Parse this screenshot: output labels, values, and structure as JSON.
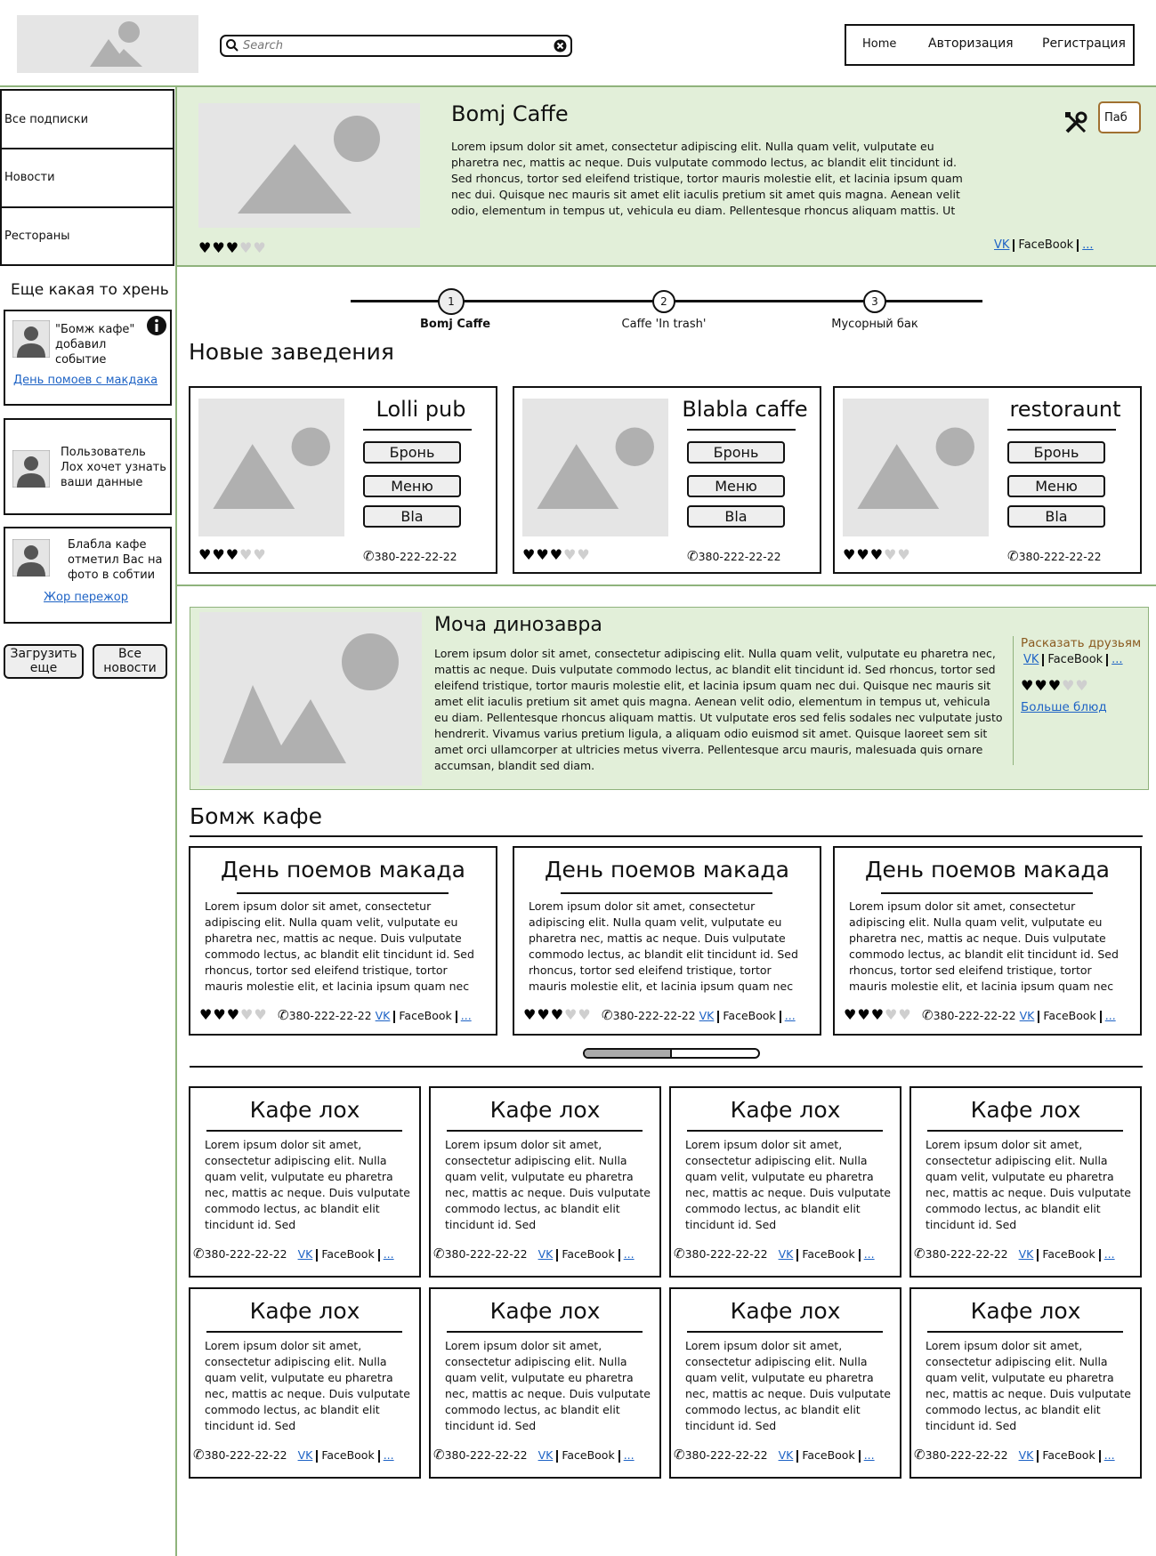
{
  "header": {
    "search_placeholder": "Search",
    "nav": [
      "Home",
      "Авторизация",
      "Регистрация"
    ]
  },
  "sidebar": {
    "menu": [
      "Все подписки",
      "Новости",
      "Рестораны"
    ],
    "section_title": "Еще какая то хрень",
    "notifications": [
      {
        "text": "\"Бомж кафе\" добавил событие",
        "link": "День помоев с макдака"
      },
      {
        "text": "Пользователь Лох хочет узнать ваши данные",
        "link": ""
      },
      {
        "text": "Блабла кафе отметил Вас на фото в собтии",
        "link": "Жор пережор"
      }
    ],
    "load_more": "Загрузить еще",
    "all_news": "Все новости"
  },
  "featured": {
    "title": "Bomj Caffe",
    "text": "Lorem ipsum dolor sit amet, consectetur adipiscing elit. Nulla quam velit, vulputate eu pharetra nec, mattis ac neque. Duis vulputate commodo lectus, ac blandit elit tincidunt id. Sed rhoncus, tortor sed eleifend tristique, tortor mauris molestie elit, et lacinia ipsum quam nec dui. Quisque nec mauris sit amet elit iaculis pretium sit amet quis magna. Aenean velit odio, elementum in tempus ut, vehicula eu diam. Pellentesque rhoncus aliquam mattis. Ut",
    "rating": 3,
    "callout": "Паб",
    "links": {
      "vk": "VK",
      "fb": "FaceBook",
      "more": "..."
    }
  },
  "stepper": {
    "steps": [
      {
        "num": "1",
        "label": "Bomj Caffe"
      },
      {
        "num": "2",
        "label": "Caffe 'In trash'"
      },
      {
        "num": "3",
        "label": "Мусорный бак"
      }
    ]
  },
  "new_places": {
    "heading": "Новые заведения",
    "cards": [
      {
        "name": "Lolli pub",
        "buttons": [
          "Бронь",
          "Меню",
          "Bla"
        ],
        "rating": 3,
        "phone": "380-222-22-22"
      },
      {
        "name": "Blabla caffe",
        "buttons": [
          "Бронь",
          "Меню",
          "Bla"
        ],
        "rating": 3,
        "phone": "380-222-22-22"
      },
      {
        "name": "restoraunt",
        "buttons": [
          "Бронь",
          "Меню",
          "Bla"
        ],
        "rating": 3,
        "phone": "380-222-22-22"
      }
    ]
  },
  "dish": {
    "title": "Моча динозавра",
    "text": "Lorem ipsum dolor sit amet, consectetur adipiscing elit. Nulla quam velit, vulputate eu pharetra nec, mattis ac neque. Duis vulputate commodo lectus, ac blandit elit tincidunt id. Sed rhoncus, tortor sed eleifend tristique, tortor mauris molestie elit, et lacinia ipsum quam nec dui. Quisque nec mauris sit amet elit iaculis pretium sit amet quis magna. Aenean velit odio, elementum in tempus ut, vehicula eu diam. Pellentesque rhoncus aliquam mattis. Ut vulputate eros sed felis sodales nec vulputate justo hendrerit. Vivamus varius pretium ligula, a aliquam odio euismod sit amet. Quisque laoreet sem sit amet orci ullamcorper at ultricies metus viverra. Pellentesque arcu mauris, malesuada quis ornare accumsan, blandit sed diam.",
    "share": "Расказать друзьям",
    "rating": 3,
    "more_dishes": "Больше блюд",
    "links": {
      "vk": "VK",
      "fb": "FaceBook",
      "more": "..."
    }
  },
  "bomj_section": {
    "heading": "Бомж кафе",
    "events": [
      {
        "title": "День поемов макада",
        "text": "Lorem ipsum dolor sit amet, consectetur adipiscing elit. Nulla quam velit, vulputate eu pharetra nec, mattis ac neque. Duis vulputate commodo lectus, ac blandit elit tincidunt id. Sed rhoncus, tortor sed eleifend tristique, tortor mauris molestie elit, et lacinia ipsum quam nec",
        "rating": 3,
        "phone": "380-222-22-22"
      },
      {
        "title": "День поемов макада",
        "text": "Lorem ipsum dolor sit amet, consectetur adipiscing elit. Nulla quam velit, vulputate eu pharetra nec, mattis ac neque. Duis vulputate commodo lectus, ac blandit elit tincidunt id. Sed rhoncus, tortor sed eleifend tristique, tortor mauris molestie elit, et lacinia ipsum quam nec",
        "rating": 3,
        "phone": "380-222-22-22"
      },
      {
        "title": "День поемов макада",
        "text": "Lorem ipsum dolor sit amet, consectetur adipiscing elit. Nulla quam velit, vulputate eu pharetra nec, mattis ac neque. Duis vulputate commodo lectus, ac blandit elit tincidunt id. Sed rhoncus, tortor sed eleifend tristique, tortor mauris molestie elit, et lacinia ipsum quam nec",
        "rating": 3,
        "phone": "380-222-22-22"
      }
    ],
    "scroll_position": 0.5
  },
  "cafes": {
    "items": [
      {
        "title": "Кафе лох",
        "text": "Lorem ipsum dolor sit amet, consectetur adipiscing elit. Nulla quam velit, vulputate eu pharetra nec, mattis ac neque. Duis vulputate commodo lectus, ac blandit elit tincidunt id. Sed",
        "phone": "380-222-22-22"
      },
      {
        "title": "Кафе лох",
        "text": "Lorem ipsum dolor sit amet, consectetur adipiscing elit. Nulla quam velit, vulputate eu pharetra nec, mattis ac neque. Duis vulputate commodo lectus, ac blandit elit tincidunt id. Sed",
        "phone": "380-222-22-22"
      },
      {
        "title": "Кафе лох",
        "text": "Lorem ipsum dolor sit amet, consectetur adipiscing elit. Nulla quam velit, vulputate eu pharetra nec, mattis ac neque. Duis vulputate commodo lectus, ac blandit elit tincidunt id. Sed",
        "phone": "380-222-22-22"
      },
      {
        "title": "Кафе лох",
        "text": "Lorem ipsum dolor sit amet, consectetur adipiscing elit. Nulla quam velit, vulputate eu pharetra nec, mattis ac neque. Duis vulputate commodo lectus, ac blandit elit tincidunt id. Sed",
        "phone": "380-222-22-22"
      },
      {
        "title": "Кафе лох",
        "text": "Lorem ipsum dolor sit amet, consectetur adipiscing elit. Nulla quam velit, vulputate eu pharetra nec, mattis ac neque. Duis vulputate commodo lectus, ac blandit elit tincidunt id. Sed",
        "phone": "380-222-22-22"
      },
      {
        "title": "Кафе лох",
        "text": "Lorem ipsum dolor sit amet, consectetur adipiscing elit. Nulla quam velit, vulputate eu pharetra nec, mattis ac neque. Duis vulputate commodo lectus, ac blandit elit tincidunt id. Sed",
        "phone": "380-222-22-22"
      },
      {
        "title": "Кафе лох",
        "text": "Lorem ipsum dolor sit amet, consectetur adipiscing elit. Nulla quam velit, vulputate eu pharetra nec, mattis ac neque. Duis vulputate commodo lectus, ac blandit elit tincidunt id. Sed",
        "phone": "380-222-22-22"
      },
      {
        "title": "Кафе лох",
        "text": "Lorem ipsum dolor sit amet, consectetur adipiscing elit. Nulla quam velit, vulputate eu pharetra nec, mattis ac neque. Duis vulputate commodo lectus, ac blandit elit tincidunt id. Sed",
        "phone": "380-222-22-22"
      }
    ]
  },
  "colors": {
    "green_panel": "#e2efd9",
    "green_border": "#8fb37c",
    "share_text": "#8a5a1f"
  },
  "icons": {
    "search": "magnifier-icon",
    "clear": "clear-icon",
    "info": "info-icon",
    "tools": "tools-icon",
    "phone": "phone-icon",
    "heart": "heart-icon",
    "avatar": "avatar-icon",
    "image": "image-placeholder-icon"
  }
}
